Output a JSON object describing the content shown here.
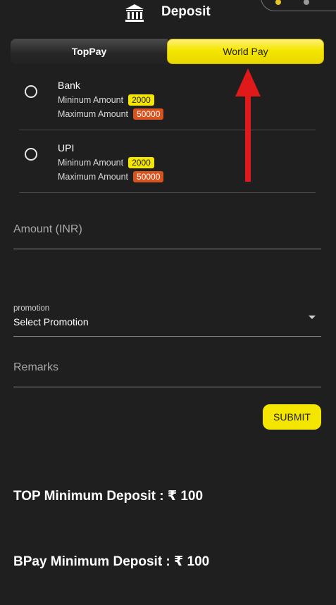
{
  "header": {
    "title": "Deposit",
    "icon": "bank-icon"
  },
  "tabs": [
    {
      "label": "TopPay",
      "active": false
    },
    {
      "label": "World Pay",
      "active": true
    }
  ],
  "methods": [
    {
      "name": "Bank",
      "min_label": "Mininum Amount",
      "min_value": "2000",
      "max_label": "Maximum Amount",
      "max_value": "50000"
    },
    {
      "name": "UPI",
      "min_label": "Mininum Amount",
      "min_value": "2000",
      "max_label": "Maximum Amount",
      "max_value": "50000"
    }
  ],
  "form": {
    "amount_placeholder": "Amount (INR)",
    "promotion_label": "promotion",
    "promotion_value": "Select Promotion",
    "remarks_placeholder": "Remarks",
    "submit_label": "SUBMIT"
  },
  "info": {
    "top_min": "TOP Minimum Deposit : ₹ 100",
    "bpay_min": "BPay Minimum Deposit : ₹ 100"
  },
  "colors": {
    "accent": "#f5e600",
    "badge_min": "#f5e600",
    "badge_max": "#d9531e",
    "background": "#1f1f1f",
    "annotation_arrow": "#e01a1a"
  }
}
